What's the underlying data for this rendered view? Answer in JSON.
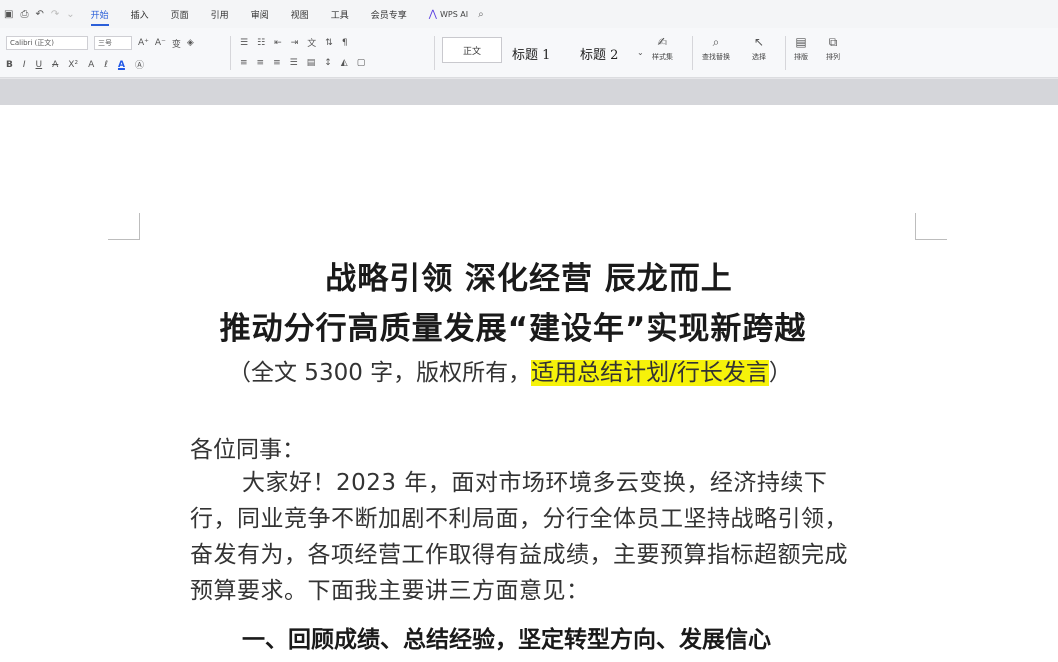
{
  "quick_access": {
    "save_icon": "save-icon",
    "print_icon": "print-icon",
    "undo_icon": "undo-icon",
    "redo_icon": "redo-icon",
    "more_icon": "chevron-down-icon"
  },
  "tabs": [
    {
      "label": "开始",
      "active": true
    },
    {
      "label": "插入",
      "active": false
    },
    {
      "label": "页面",
      "active": false
    },
    {
      "label": "引用",
      "active": false
    },
    {
      "label": "审阅",
      "active": false
    },
    {
      "label": "视图",
      "active": false
    },
    {
      "label": "工具",
      "active": false
    },
    {
      "label": "会员专享",
      "active": false
    }
  ],
  "wps_ai": {
    "label": "WPS AI"
  },
  "ribbon": {
    "font_name": "Calibri (正文)",
    "font_size": "三号",
    "style_normal": "正文",
    "style_h1": "标题 1",
    "style_h2": "标题 2",
    "styles_label": "样式集",
    "find_label": "查找替换",
    "select_label": "选择",
    "layout_label": "排版",
    "arrange_label": "排列"
  },
  "document": {
    "title_line1": "战略引领  深化经营  辰龙而上",
    "title_line2": "推动分行高质量发展“建设年”实现新跨越",
    "subtitle_prefix": "（全文 5300 字，版权所有，",
    "subtitle_highlight": "适用总结计划/行长发言",
    "subtitle_suffix": "）",
    "greeting": "各位同事：",
    "paragraph": "大家好！2023 年，面对市场环境多云变换，经济持续下行，同业竞争不断加剧不利局面，分行全体员工坚持战略引领，奋发有为，各项经营工作取得有益成绩，主要预算指标超额完成预算要求。下面我主要讲三方面意见：",
    "section_heading": "一、回顾成绩、总结经验，坚定转型方向、发展信心"
  },
  "colors": {
    "accent": "#2b5fd9",
    "highlight": "#f6f20a",
    "page_bg": "#ffffff"
  }
}
